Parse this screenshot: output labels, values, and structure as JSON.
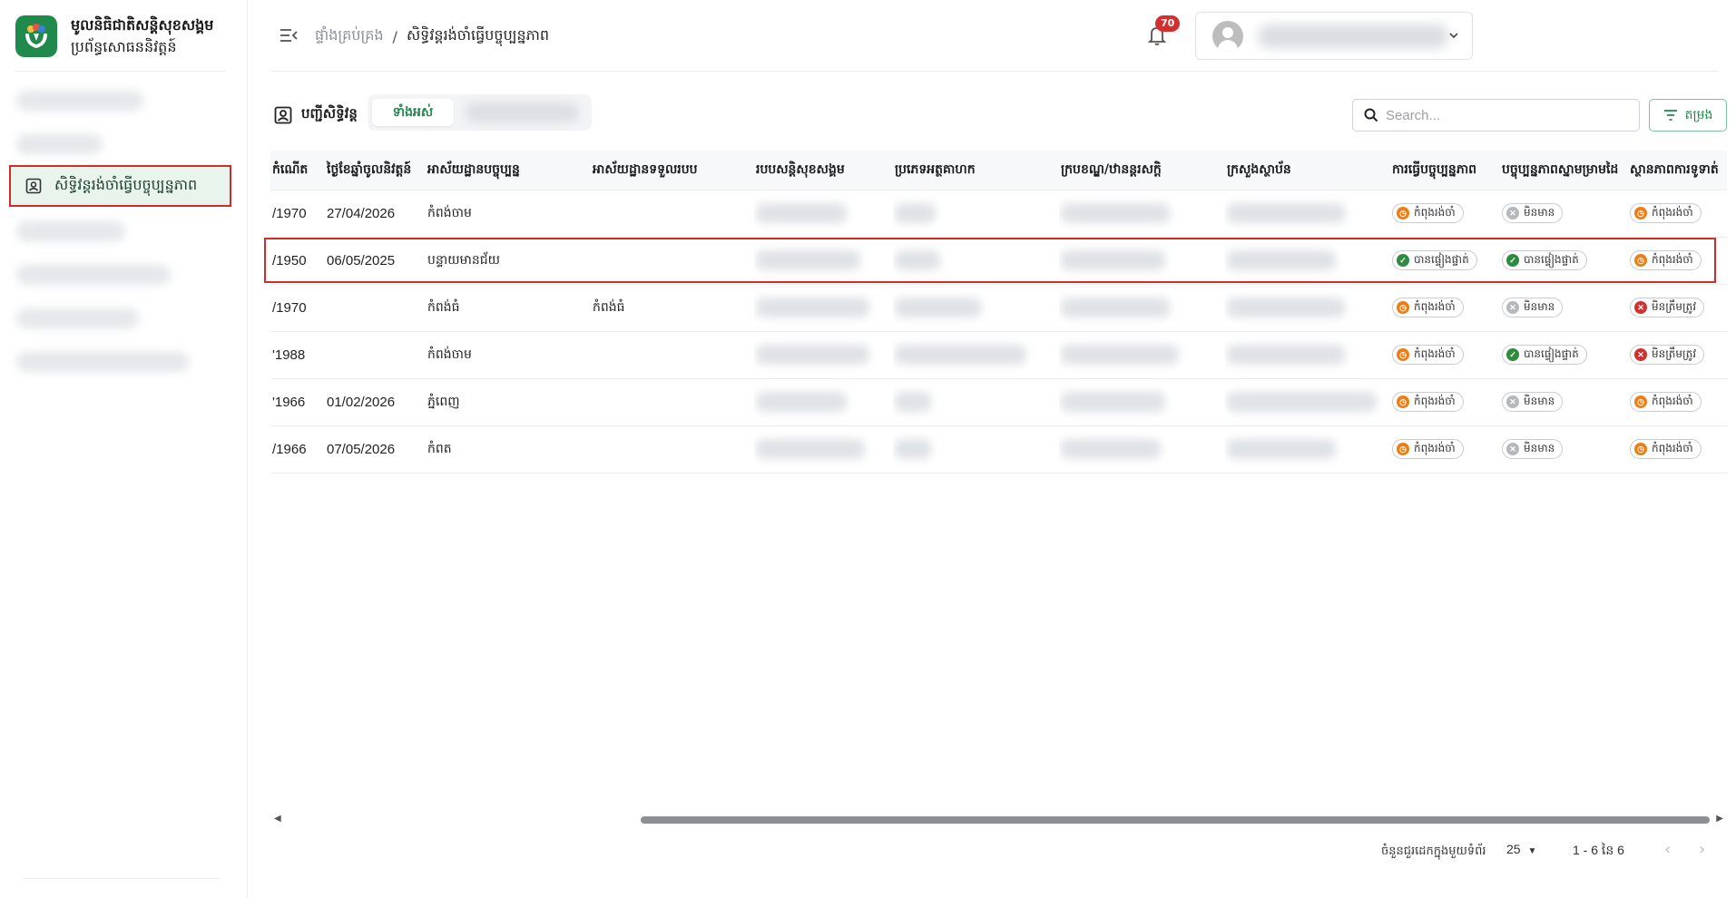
{
  "brand": {
    "title": "មូលនិធិជាតិសន្តិសុខសង្គម",
    "subtitle": "ប្រព័ន្ធសោធននិវត្តន៍"
  },
  "sidebar": {
    "active_item": "សិទ្ធិវន្តរង់ចាំធ្វើបច្ចុប្បន្នភាព"
  },
  "header": {
    "breadcrumb_home": "ផ្ទាំងគ្រប់គ្រង",
    "breadcrumb_separator": "/",
    "breadcrumb_current": "សិទ្ធិវន្តរង់ចាំធ្វើបច្ចុប្បន្នភាព",
    "notification_count": "70"
  },
  "toolbar": {
    "list_title": "បញ្ជីសិទ្ធិវន្ត",
    "tab_all": "ទាំងអស់",
    "search_placeholder": "Search...",
    "filter_label": "តម្រង"
  },
  "table": {
    "columns": [
      "កំណើត",
      "ថ្ងៃខែឆ្នាំចូលនិវត្តន៍",
      "អាស័យដ្ឋានបច្ចុប្បន្ន",
      "អាស័យដ្ឋានទទួលរបប",
      "របបសន្តិសុខសង្គម",
      "ប្រភេទអត្ថគាហក",
      "ក្របខណ្ឌ/ឋានន្តរសក្តិ",
      "ក្រសួងស្ថាប័ន",
      "ការធ្វើបច្ចុប្បន្នភាព",
      "បច្ចុប្បន្នភាពស្នាមម្រាមដៃ",
      "ស្ថានភាពការទូទាត់"
    ],
    "rows": [
      {
        "birth": "/1970",
        "retire_date": "27/04/2026",
        "current_address": "កំពង់ចាម",
        "receive_address": "",
        "update": {
          "label": "កំពុងរង់ចាំ",
          "state": "pending"
        },
        "fingerprint": {
          "label": "មិនមាន",
          "state": "none"
        },
        "payment": {
          "label": "កំពុងរង់ចាំ",
          "state": "pending"
        }
      },
      {
        "birth": "/1950",
        "retire_date": "06/05/2025",
        "current_address": "បន្ទាយមានជ័យ",
        "receive_address": "",
        "update": {
          "label": "បានផ្ទៀងផ្ទាត់",
          "state": "success"
        },
        "fingerprint": {
          "label": "បានផ្ទៀងផ្ទាត់",
          "state": "success"
        },
        "payment": {
          "label": "កំពុងរង់ចាំ",
          "state": "pending"
        }
      },
      {
        "birth": "/1970",
        "retire_date": "",
        "current_address": "កំពង់ធំ",
        "receive_address": "កំពង់ធំ",
        "update": {
          "label": "កំពុងរង់ចាំ",
          "state": "pending"
        },
        "fingerprint": {
          "label": "មិនមាន",
          "state": "none"
        },
        "payment": {
          "label": "មិនត្រឹមត្រូវ",
          "state": "error"
        }
      },
      {
        "birth": "'1988",
        "retire_date": "",
        "current_address": "កំពង់ចាម",
        "receive_address": "",
        "update": {
          "label": "កំពុងរង់ចាំ",
          "state": "pending"
        },
        "fingerprint": {
          "label": "បានផ្ទៀងផ្ទាត់",
          "state": "success"
        },
        "payment": {
          "label": "មិនត្រឹមត្រូវ",
          "state": "error"
        }
      },
      {
        "birth": "'1966",
        "retire_date": "01/02/2026",
        "current_address": "ភ្នំពេញ",
        "receive_address": "",
        "update": {
          "label": "កំពុងរង់ចាំ",
          "state": "pending"
        },
        "fingerprint": {
          "label": "មិនមាន",
          "state": "none"
        },
        "payment": {
          "label": "កំពុងរង់ចាំ",
          "state": "pending"
        }
      },
      {
        "birth": "/1966",
        "retire_date": "07/05/2026",
        "current_address": "កំពត",
        "receive_address": "",
        "update": {
          "label": "កំពុងរង់ចាំ",
          "state": "pending"
        },
        "fingerprint": {
          "label": "មិនមាន",
          "state": "none"
        },
        "payment": {
          "label": "កំពុងរង់ចាំ",
          "state": "pending"
        }
      }
    ]
  },
  "pagination": {
    "rows_per_page_label": "ចំនួនជួរដេកក្នុងមួយទំព័រ",
    "rows_per_page": "25",
    "range": "1 - 6 នៃ 6"
  },
  "colors": {
    "brand_green": "#1f8a4c",
    "active_bg": "#e9f4ed",
    "highlight_red": "#d12c2c",
    "pending_orange": "#ef7d12",
    "success_green": "#2e8b3f",
    "error_red": "#d32f2f",
    "none_gray": "#b5b8bd"
  },
  "icons": {
    "pending": "clock-icon",
    "success": "check-icon",
    "none": "x-gray-icon",
    "error": "x-red-icon"
  }
}
